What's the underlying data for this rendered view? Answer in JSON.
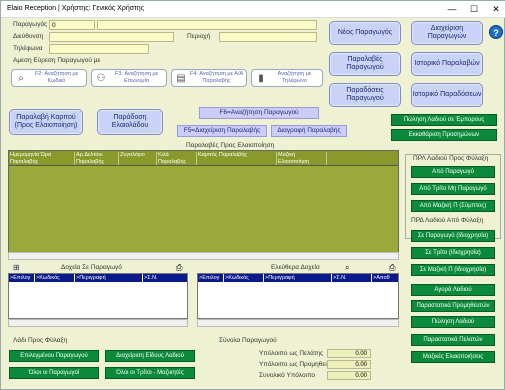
{
  "window": {
    "title": "Elaio Reception | Χρήστης: Γενικός Χρήστης",
    "min": "—",
    "max": "☐",
    "close": "✕"
  },
  "producer": {
    "code_label": "Παραγωγός",
    "code_value": "0",
    "address_label": "Διεύθυνση",
    "area_label": "Περιοχή",
    "phone_label": "Τηλέφωνα",
    "quick_search_label": "Αμεση Εύρεση Παραγωγού με"
  },
  "search_buttons": [
    {
      "label": "F2: Αναζήτηση με Κωδικό",
      "icon": "search-icon"
    },
    {
      "label": "F3: Αναζήτηση με Επωνυμία",
      "icon": "people-search-icon"
    },
    {
      "label": "F4: Αναζήτηση με Α/Α Παραλαβής",
      "icon": "document-icon"
    },
    {
      "label": "Αναζήτηση με Τηλέφωνο",
      "icon": "phone-icon"
    }
  ],
  "top_buttons": {
    "new_producer": "Νέος Παραγωγός",
    "manage_producers": "Διαχείριση Παραγωγών",
    "producer_receipts": "Παραλαβές Παραγωγού",
    "receipts_history": "Ιστορικό Παραλαβών",
    "producer_deliveries": "Παραδόσεις Παραγωγού",
    "deliveries_history": "Ιστορικό Παραδόσεων"
  },
  "actions": {
    "receive_fruit": "Παραλαβή Καρπού (Προς Ελαιοποίηση)",
    "deliver_oil": "Παράδοση Ελαιολάδου",
    "f6_search": "F6=Αναζήτηση Παραγωγού",
    "f5_manage": "F5=Διαχείριση Παραλαβής",
    "delete_receipt": "Διαγραφή Παραλαβής",
    "sell_oil_merchant": "Πώληση Λαδιού σε Έμπορους",
    "clear_advances": "Εκκαθάριση Προσημώνων"
  },
  "receipts_grid": {
    "title": "Παραλαβές Προς Ελαιοποίηση",
    "columns": [
      "Ημερομηνία Ώρα Παραλαβής",
      "Αρ.Δελτίου Παραλαβής",
      "Ζυγολόγιο",
      "Κιλά Παραλαβής",
      "Καρπός Παραλαβής",
      "Μαζική Ελαιοποίηση"
    ]
  },
  "tanks": {
    "title": "Δοχεία Σε Παραγωγό",
    "columns": [
      ">Επιλογ",
      ">Κωδικός",
      ">Περιγραφή",
      ">Σ.Ν."
    ]
  },
  "free_tanks": {
    "title": "Ελεύθερα Δοχεία",
    "columns": [
      ">Επιλογ",
      ">Κωδικός",
      ">Περιγραφή",
      ">Σ.Ν.",
      ">Αποθ"
    ]
  },
  "right_panel": {
    "oil_storage_title": "ΠΡΛ Λαδιού Προς Φύλαξη",
    "from_producer": "Από Παραγωγό",
    "from_third": "Από Τρίτο  Μη Παραγωγό",
    "from_bulk": "Από Μαζική Π (Σύμπτος)",
    "oil_from_storage_title": "ΠΡΔ Λαδιού Από Φύλαξη",
    "to_producer_own": "Σε Παραγωγό (Ιδιοχρησία)",
    "to_third_own": "Σε Τρίτο (Ιδιοχρησία)",
    "to_bulk_own": "Σε Μαζική Π (Ιδιοχρησία)",
    "buy_oil": "Αγορά Λαδιού",
    "supplier_proof": "Παραστατικά Προμηθευτών",
    "sell_oil": "Πώληση Λαδιού",
    "customer_proof": "Παραστατικά Πελατών",
    "bulk_processing": "Μαζικές Ελαιοποιήσεις"
  },
  "oil_storage": {
    "title": "Λάδι Προς Φύλαξη",
    "selected_producer": "Επιλεγμένου Παραγωγού",
    "manage_oil_type": "Διαχείριση Είδους Λαδιού",
    "all_producers": "Όλοι οι Παραγωγοί",
    "all_third": "Όλοι οι Τρίτοι - Μαζικητές"
  },
  "totals": {
    "title": "Σύνολα Παραγωγού",
    "customer_balance_label": "Υπόλοιπο ως Πελάτης",
    "customer_balance": "0.00",
    "supplier_balance_label": "Υπόλοιπο ως Προμηθευτής",
    "supplier_balance": "0.00",
    "total_balance_label": "Συνολικό Υπόλοιπο",
    "total_balance": "0.00"
  },
  "help_icon": "?"
}
